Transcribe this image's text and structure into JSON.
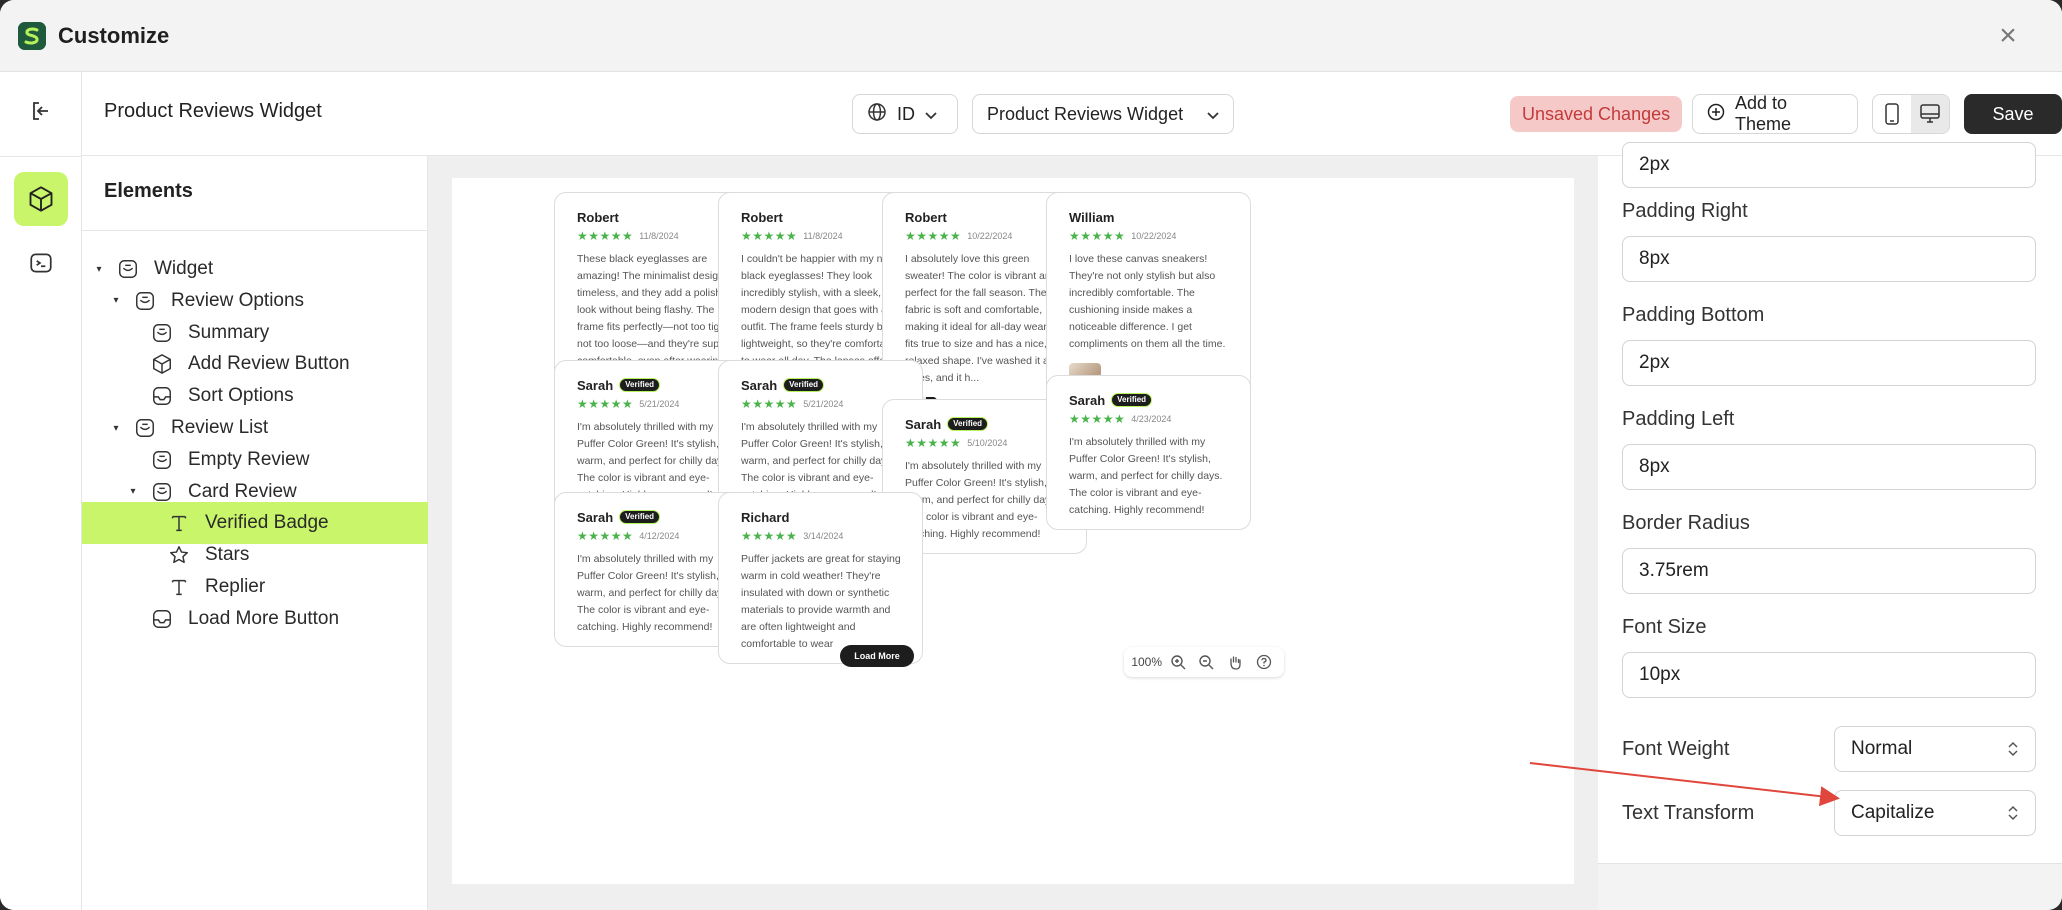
{
  "window": {
    "title": "Customize",
    "close_glyph": "×"
  },
  "header": {
    "page_title": "Product Reviews Widget",
    "language": "ID",
    "widget_select": "Product Reviews Widget",
    "unsaved_label": "Unsaved Changes",
    "add_to_theme_label": "Add to Theme",
    "save_label": "Save"
  },
  "elements_panel": {
    "title": "Elements",
    "tree": [
      {
        "label": "Widget",
        "depth": 0,
        "caret": true,
        "icon": "component-icon"
      },
      {
        "label": "Review Options",
        "depth": 1,
        "caret": true,
        "icon": "component-icon"
      },
      {
        "label": "Summary",
        "depth": 2,
        "caret": false,
        "icon": "component-icon"
      },
      {
        "label": "Add Review Button",
        "depth": 2,
        "caret": false,
        "icon": "cube-icon"
      },
      {
        "label": "Sort Options",
        "depth": 2,
        "caret": false,
        "icon": "box-icon"
      },
      {
        "label": "Review List",
        "depth": 1,
        "caret": true,
        "icon": "component-icon"
      },
      {
        "label": "Empty Review",
        "depth": 2,
        "caret": false,
        "icon": "component-icon"
      },
      {
        "label": "Card Review",
        "depth": 2,
        "caret": true,
        "icon": "component-icon"
      },
      {
        "label": "Verified Badge",
        "depth": 3,
        "caret": false,
        "icon": "text-icon",
        "selected": true
      },
      {
        "label": "Stars",
        "depth": 3,
        "caret": false,
        "icon": "star-icon"
      },
      {
        "label": "Replier",
        "depth": 3,
        "caret": false,
        "icon": "text-icon"
      },
      {
        "label": "Load More Button",
        "depth": 2,
        "caret": false,
        "icon": "box-icon"
      }
    ]
  },
  "preview": {
    "verified_label": "Verified",
    "stars_glyph": "★★★★★",
    "load_more_label": "Load More",
    "zoom_level": "100%",
    "cards": [
      {
        "name": "Robert",
        "date": "11/8/2024",
        "verified": false,
        "text": "These black eyeglasses are amazing! The minimalist design is timeless, and they add a polished look without being flashy. The frame fits perfectly—not too tight, not too loose—and they're super comfortable, even after wearing them for hours. The qual...",
        "thumb": ""
      },
      {
        "name": "Robert",
        "date": "11/8/2024",
        "verified": false,
        "text": "I couldn't be happier with my new black eyeglasses! They look incredibly stylish, with a sleek, modern design that goes with any outfit. The frame feels sturdy but lightweight, so they're comfortable to wear all day. The lenses offer clear vision wit...",
        "thumb": ""
      },
      {
        "name": "Robert",
        "date": "10/22/2024",
        "verified": false,
        "text": "I absolutely love this green sweater! The color is vibrant and perfect for the fall season. The fabric is soft and comfortable, making it ideal for all-day wear. It fits true to size and has a nice, relaxed shape. I've washed it a few times, and it h...",
        "thumb": "dark"
      },
      {
        "name": "William",
        "date": "10/22/2024",
        "verified": false,
        "text": "I love these canvas sneakers! They're not only stylish but also incredibly comfortable. The cushioning inside makes a noticeable difference. I get compliments on them all the time.",
        "thumb": "light"
      },
      {
        "name": "Sarah",
        "date": "5/21/2024",
        "verified": true,
        "text": "I'm absolutely thrilled with my Puffer Color Green! It's stylish, warm, and perfect for chilly days. The color is vibrant and eye-catching. Highly recommend!",
        "thumb": ""
      },
      {
        "name": "Sarah",
        "date": "5/21/2024",
        "verified": true,
        "text": "I'm absolutely thrilled with my Puffer Color Green! It's stylish, warm, and perfect for chilly days. The color is vibrant and eye-catching. Highly recommend!",
        "thumb": ""
      },
      {
        "name": "Sarah",
        "date": "5/10/2024",
        "verified": true,
        "text": "I'm absolutely thrilled with my Puffer Color Green! It's stylish, warm, and perfect for chilly days. The color is vibrant and eye-catching. Highly recommend!",
        "thumb": ""
      },
      {
        "name": "Sarah",
        "date": "4/23/2024",
        "verified": true,
        "text": "I'm absolutely thrilled with my Puffer Color Green! It's stylish, warm, and perfect for chilly days. The color is vibrant and eye-catching. Highly recommend!",
        "thumb": ""
      },
      {
        "name": "Sarah",
        "date": "4/12/2024",
        "verified": true,
        "text": "I'm absolutely thrilled with my Puffer Color Green! It's stylish, warm, and perfect for chilly days. The color is vibrant and eye-catching. Highly recommend!",
        "thumb": ""
      },
      {
        "name": "Richard",
        "date": "3/14/2024",
        "verified": false,
        "text": "Puffer jackets are great for staying warm in cold weather! They're insulated with down or synthetic materials to provide warmth and are often lightweight and comfortable to wear",
        "thumb": ""
      }
    ]
  },
  "properties": {
    "padding_top_value": "2px",
    "padding_right": {
      "label": "Padding Right",
      "value": "8px"
    },
    "padding_bottom": {
      "label": "Padding Bottom",
      "value": "2px"
    },
    "padding_left": {
      "label": "Padding Left",
      "value": "8px"
    },
    "border_radius": {
      "label": "Border Radius",
      "value": "3.75rem"
    },
    "font_size": {
      "label": "Font Size",
      "value": "10px"
    },
    "font_weight": {
      "label": "Font Weight",
      "value": "Normal"
    },
    "text_transform": {
      "label": "Text Transform",
      "value": "Capitalize"
    }
  },
  "colors": {
    "accent": "#c8f56a",
    "unsaved_bg": "#f6c9c9",
    "unsaved_text": "#c33a3a",
    "stars": "#4bb34b",
    "annotation_arrow": "#e0463c"
  }
}
